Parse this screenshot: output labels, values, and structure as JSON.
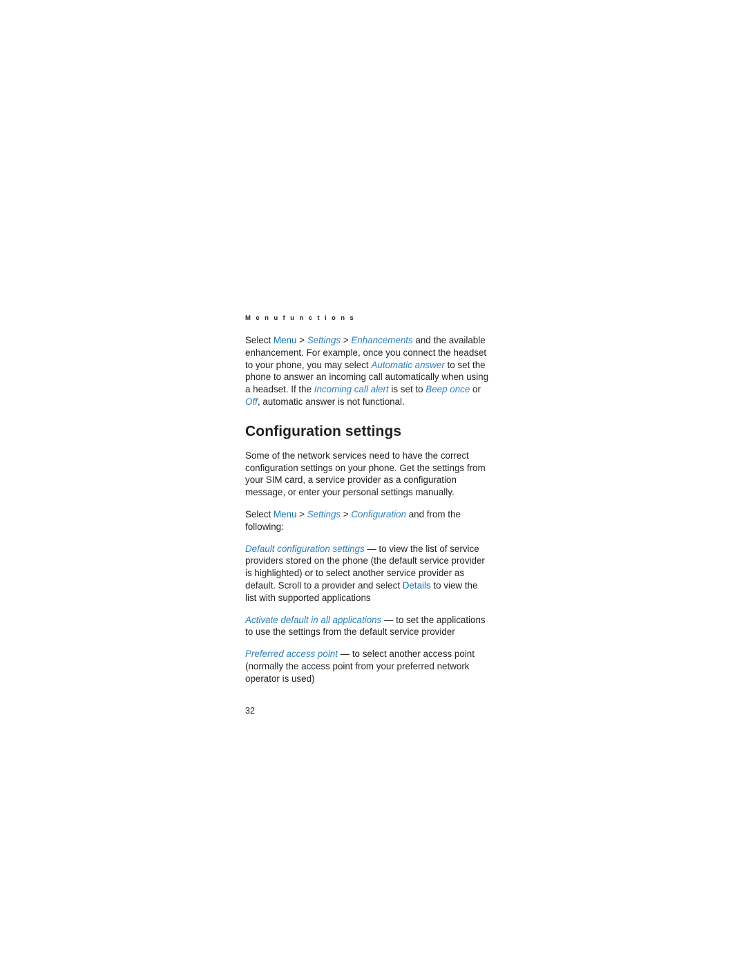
{
  "running_head": "M e n u   f u n c t i o n s",
  "paragraphs": {
    "enhancements": {
      "p1_a": "Select ",
      "p1_menu": "Menu",
      "p1_b": " > ",
      "p1_settings": "Settings",
      "p1_c": " > ",
      "p1_enhancements": "Enhancements",
      "p1_d": " and the available enhancement. For example, once you connect the headset to your phone, you may select ",
      "p1_auto": "Automatic answer",
      "p1_e": " to set the phone to answer an incoming call automatically when using a headset. If the ",
      "p1_alert": "Incoming call alert",
      "p1_f": " is set to ",
      "p1_beep": "Beep once",
      "p1_g": " or ",
      "p1_off": "Off",
      "p1_h": ", automatic answer is not functional."
    }
  },
  "heading": "Configuration settings",
  "body": {
    "intro": "Some of the network services need to have the correct configuration settings on your phone. Get the settings from your SIM card, a service provider as a configuration message, or enter your personal settings manually.",
    "select_a": "Select ",
    "select_menu": "Menu",
    "select_b": " > ",
    "select_settings": "Settings",
    "select_c": " > ",
    "select_configuration": "Configuration",
    "select_d": " and from the following:",
    "item1_term": "Default configuration settings",
    "item1_text_a": " — to view the list of service providers stored on the phone (the default service provider is highlighted) or to select another service provider as default. Scroll to a provider and select ",
    "item1_details": "Details",
    "item1_text_b": " to view the list with supported applications",
    "item2_term": "Activate default in all applications",
    "item2_text": " — to set the applications to use the settings from the default service provider",
    "item3_term": "Preferred access point",
    "item3_text": " — to select another access point (normally the access point from your preferred network operator is used)"
  },
  "page_number": "32",
  "colors": {
    "text": "#231f20",
    "link_blue": "#0a6fb5",
    "italic_blue": "#2a7fbf"
  }
}
